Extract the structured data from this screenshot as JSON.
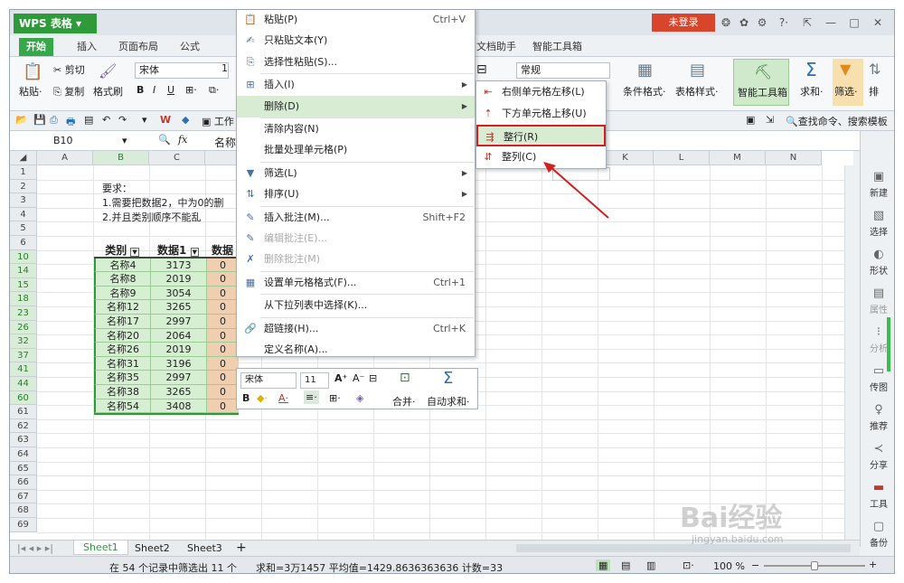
{
  "window": {
    "app_title": "WPS 表格",
    "login_label": "未登录",
    "icons": [
      "refresh-icon",
      "skin-icon",
      "settings-icon",
      "help-icon",
      "restore-icon",
      "minimize-icon",
      "maximize-icon",
      "close-icon"
    ],
    "help_label": "?·"
  },
  "ribbon_tabs": [
    "开始",
    "插入",
    "页面布局",
    "公式",
    "文档助手",
    "智能工具箱"
  ],
  "ribbon": {
    "paste": "粘贴·",
    "cut": "剪切",
    "copy": "复制",
    "format_painter": "格式刷",
    "font_name": "宋体",
    "font_size": "1",
    "number_format": "常规",
    "cond_format": "条件格式·",
    "table_style": "表格样式·",
    "smart_toolbox": "智能工具箱",
    "sum": "求和·",
    "filter": "筛选·",
    "sort": "排"
  },
  "quickbar": {
    "work_label": "工作",
    "search": "查找命令、搜索模板"
  },
  "formula": {
    "cell_ref": "B10",
    "fx": "fx",
    "content": "名称"
  },
  "sheet": {
    "columns": [
      "A",
      "B",
      "C",
      "",
      "",
      "",
      "",
      "",
      "",
      "",
      "K",
      "L",
      "M",
      "N"
    ],
    "row_numbers": [
      "1",
      "2",
      "3",
      "4",
      "5",
      "6",
      "10",
      "14",
      "15",
      "18",
      "23",
      "26",
      "32",
      "37",
      "41",
      "44",
      "60",
      "61",
      "62",
      "63",
      "64",
      "65",
      "66",
      "67",
      "68",
      "69"
    ],
    "requirement_lines": [
      "要求：",
      "1.需要把数据2，中为0的删",
      "2.并且类别顺序不能乱"
    ],
    "headers": [
      "类别",
      "数据1",
      "数据"
    ],
    "rows": [
      [
        "名称4",
        "3173",
        "0"
      ],
      [
        "名称8",
        "2019",
        "0"
      ],
      [
        "名称9",
        "3054",
        "0"
      ],
      [
        "名称12",
        "3265",
        "0"
      ],
      [
        "名称17",
        "2997",
        "0"
      ],
      [
        "名称20",
        "2064",
        "0"
      ],
      [
        "名称26",
        "2019",
        "0"
      ],
      [
        "名称31",
        "3196",
        "0"
      ],
      [
        "名称35",
        "2997",
        "0"
      ],
      [
        "名称38",
        "3265",
        "0"
      ],
      [
        "名称54",
        "3408",
        "0"
      ]
    ]
  },
  "context_menu": [
    {
      "label": "粘贴(P)",
      "shortcut": "Ctrl+V",
      "icon": "paste-icon"
    },
    {
      "label": "只粘贴文本(Y)",
      "shortcut": "",
      "icon": "paste-text-icon"
    },
    {
      "label": "选择性粘贴(S)...",
      "shortcut": "",
      "icon": "paste-special-icon"
    },
    {
      "label": "插入(I)",
      "shortcut": "",
      "icon": "insert-icon",
      "arrow": true
    },
    {
      "label": "删除(D)",
      "shortcut": "",
      "icon": "",
      "arrow": true,
      "highlight": true
    },
    {
      "label": "清除内容(N)",
      "shortcut": "",
      "icon": ""
    },
    {
      "label": "批量处理单元格(P)",
      "shortcut": "",
      "icon": ""
    },
    {
      "label": "筛选(L)",
      "shortcut": "",
      "icon": "filter-icon",
      "arrow": true
    },
    {
      "label": "排序(U)",
      "shortcut": "",
      "icon": "sort-icon",
      "arrow": true
    },
    {
      "label": "插入批注(M)...",
      "shortcut": "Shift+F2",
      "icon": "comment-icon"
    },
    {
      "label": "编辑批注(E)...",
      "shortcut": "",
      "icon": "edit-comment-icon",
      "disabled": true
    },
    {
      "label": "删除批注(M)",
      "shortcut": "",
      "icon": "delete-comment-icon",
      "disabled": true
    },
    {
      "label": "设置单元格格式(F)...",
      "shortcut": "Ctrl+1",
      "icon": "format-cells-icon"
    },
    {
      "label": "从下拉列表中选择(K)...",
      "shortcut": "",
      "icon": ""
    },
    {
      "label": "超链接(H)...",
      "shortcut": "Ctrl+K",
      "icon": "hyperlink-icon"
    },
    {
      "label": "定义名称(A)...",
      "shortcut": "",
      "icon": ""
    }
  ],
  "delete_submenu": [
    {
      "label": "右侧单元格左移(L)",
      "icon": "shift-left-icon"
    },
    {
      "label": "下方单元格上移(U)",
      "icon": "shift-up-icon"
    },
    {
      "label": "整行(R)",
      "icon": "entire-row-icon",
      "boxed": true
    },
    {
      "label": "整列(C)",
      "icon": "entire-column-icon"
    }
  ],
  "mini_toolbar": {
    "font": "宋体",
    "size": "11",
    "merge": "合并·",
    "autosum": "自动求和·"
  },
  "side_panel": [
    "新建",
    "选择",
    "形状",
    "属性",
    "分析",
    "传图",
    "推荐",
    "分享",
    "工具",
    "备份"
  ],
  "sheet_tabs": [
    "Sheet1",
    "Sheet2",
    "Sheet3",
    "+"
  ],
  "status": {
    "filter_info": "在 54 个记录中筛选出 11 个",
    "stats": "求和=3万1457  平均值=1429.8636363636  计数=33",
    "zoom": "100 %"
  },
  "watermark": {
    "text": "Bai经验",
    "sub": "jingyan.baidu.com"
  },
  "colors": {
    "green": "#36a84a",
    "red": "#d9452a",
    "highlight": "#d7ecd3",
    "cell_green": "#d6efd2",
    "cell_orange": "#f0cfb0"
  }
}
